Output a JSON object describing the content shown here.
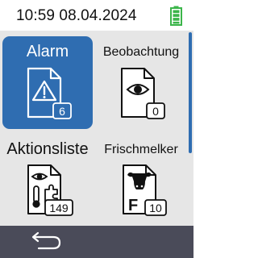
{
  "status": {
    "datetime": "10:59 08.04.2024",
    "battery_icon": "battery-full-icon",
    "battery_color": "#3bb54a"
  },
  "tiles": [
    {
      "label": "Alarm",
      "count": "6",
      "icon": "alarm-document-icon",
      "selected": true
    },
    {
      "label": "Beobachtung",
      "count": "0",
      "icon": "eye-document-icon",
      "selected": false
    },
    {
      "label": "Aktionsliste",
      "count": "149",
      "icon": "action-list-document-icon",
      "selected": false
    },
    {
      "label": "Frischmelker",
      "count": "10",
      "icon": "fresh-cow-document-icon",
      "selected": false
    }
  ],
  "bottom": {
    "back_icon": "back-arrow-icon"
  },
  "colors": {
    "accent": "#2f6db1",
    "grid_bg": "#e6e6e6",
    "bottom_bar": "#4a4b59"
  }
}
